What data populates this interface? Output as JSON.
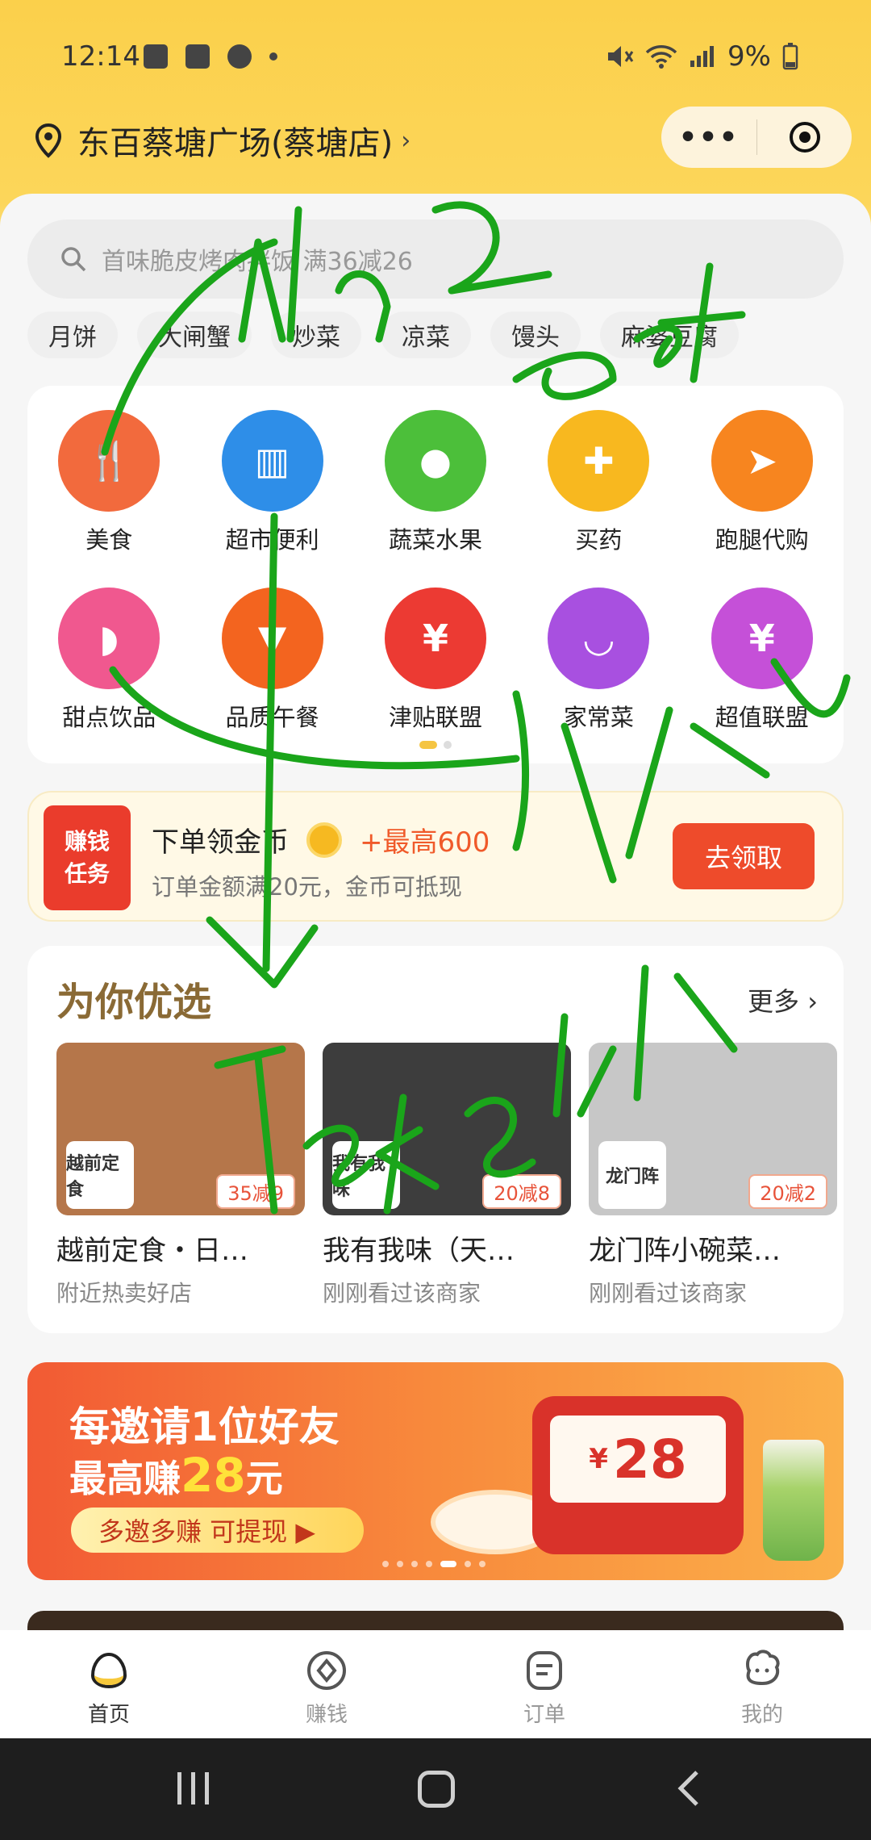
{
  "status": {
    "time": "12:14",
    "battery": "9%"
  },
  "location": {
    "name": "东百蔡塘广场(蔡塘店)",
    "chevron": "›"
  },
  "capsule": {
    "more": "•••"
  },
  "search": {
    "placeholder": "首味脆皮烤肉拌饭 满36减26"
  },
  "chips": [
    "月饼",
    "大闸蟹",
    "炒菜",
    "凉菜",
    "馒头",
    "麻婆豆腐"
  ],
  "categories": [
    {
      "label": "美食",
      "icon": "utensils-icon",
      "color": "#f26a3d",
      "glyph": "🍴"
    },
    {
      "label": "超市便利",
      "icon": "basket-icon",
      "color": "#2e8ee8",
      "glyph": "▥"
    },
    {
      "label": "蔬菜水果",
      "icon": "apple-icon",
      "color": "#4cbf3a",
      "glyph": "●"
    },
    {
      "label": "买药",
      "icon": "medkit-icon",
      "color": "#f8b81f",
      "glyph": "✚"
    },
    {
      "label": "跑腿代购",
      "icon": "runner-icon",
      "color": "#f7851f",
      "glyph": "➤"
    },
    {
      "label": "甜点饮品",
      "icon": "wine-glass-icon",
      "color": "#f0588f",
      "glyph": "◗"
    },
    {
      "label": "品质午餐",
      "icon": "lunch-bag-icon",
      "color": "#f3641f",
      "glyph": "▼"
    },
    {
      "label": "津贴联盟",
      "icon": "money-bag-icon",
      "color": "#ec3a33",
      "glyph": "¥"
    },
    {
      "label": "家常菜",
      "icon": "bowl-icon",
      "color": "#a850e0",
      "glyph": "◡"
    },
    {
      "label": "超值联盟",
      "icon": "piggy-bank-icon",
      "color": "#c550d8",
      "glyph": "¥"
    }
  ],
  "earn": {
    "badge_line1": "赚钱",
    "badge_line2": "任务",
    "title": "下单领金币",
    "bonus": "+最高600",
    "subtitle": "订单金额满20元，金币可抵现",
    "button": "去领取"
  },
  "picks": {
    "title": "为你优选",
    "more": "更多 ›",
    "shops": [
      {
        "name": "越前定食・日…",
        "sub": "附近热卖好店",
        "discount": "35减9",
        "logo_text": "越前定食",
        "color": "#b5764a"
      },
      {
        "name": "我有我味（天…",
        "sub": "刚刚看过该商家",
        "discount": "20减8",
        "logo_text": "我有我味",
        "color": "#3d3d3d"
      },
      {
        "name": "龙门阵小碗菜…",
        "sub": "刚刚看过该商家",
        "discount": "20减2",
        "logo_text": "龙门阵",
        "color": "#c7c7c7"
      }
    ]
  },
  "banner": {
    "line1": "每邀请1位好友",
    "line2_prefix": "最高赚",
    "line2_amount": "28",
    "line2_suffix": "元",
    "cta": "多邀多赚 可提现 ▶",
    "ticket_yen": "¥",
    "ticket_amount": "28"
  },
  "tabs": [
    {
      "label": "首页",
      "icon": "home-egg-icon",
      "active": true
    },
    {
      "label": "赚钱",
      "icon": "earn-icon",
      "active": false
    },
    {
      "label": "订单",
      "icon": "order-icon",
      "active": false
    },
    {
      "label": "我的",
      "icon": "profile-icon",
      "active": false
    }
  ],
  "handwriting": [
    "Bath 2",
    "east",
    "Street",
    "Takeaway"
  ],
  "colors": {
    "accent": "#fbd04b",
    "primary_button": "#ee4b2b",
    "handwriting": "#1aa51a"
  }
}
